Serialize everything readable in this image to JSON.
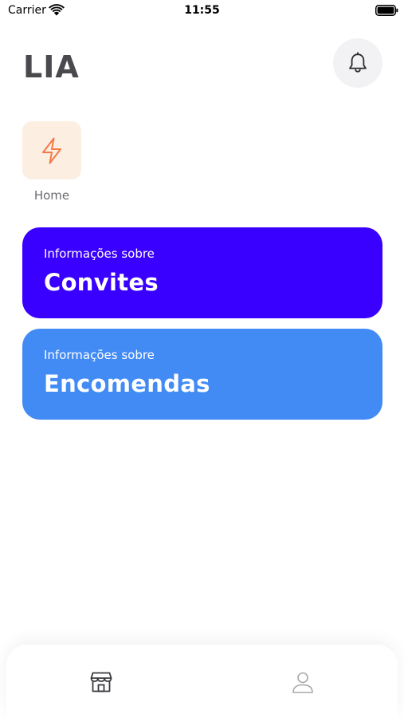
{
  "status_bar": {
    "carrier": "Carrier",
    "time": "11:55",
    "wifi_icon": "wifi-icon",
    "battery_icon": "battery-icon"
  },
  "header": {
    "title": "LIA",
    "notification_icon": "bell-icon"
  },
  "shortcuts": [
    {
      "label": "Home",
      "icon": "lightning-icon",
      "icon_color": "#f47a45",
      "tile_color": "#fdeee2"
    }
  ],
  "cards": [
    {
      "subtitle": "Informações sobre",
      "title": "Convites",
      "color": "#3a00ff"
    },
    {
      "subtitle": "Informações sobre",
      "title": "Encomendas",
      "color": "#428bf5"
    }
  ],
  "tab_bar": {
    "tabs": [
      {
        "icon": "store-icon",
        "active": true
      },
      {
        "icon": "user-icon",
        "active": false
      }
    ]
  },
  "colors": {
    "title_text": "#4a4a4e",
    "active_tab": "#3a3a3e",
    "inactive_tab": "#a9a9ae"
  }
}
